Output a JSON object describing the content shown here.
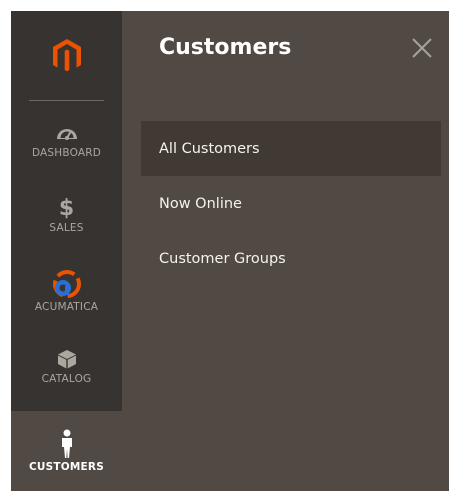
{
  "sidebar": {
    "logo_icon": "magento-logo-icon",
    "items": [
      {
        "label": "DASHBOARD",
        "icon": "dashboard-gauge-icon"
      },
      {
        "label": "SALES",
        "icon": "dollar-icon"
      },
      {
        "label": "ACUMATICA",
        "icon": "acumatica-logo-icon"
      },
      {
        "label": "CATALOG",
        "icon": "box-icon"
      },
      {
        "label": "CUSTOMERS",
        "icon": "person-icon"
      }
    ],
    "active_item": "CUSTOMERS"
  },
  "panel": {
    "title": "Customers",
    "close_icon": "close-icon",
    "items": [
      {
        "label": "All Customers"
      },
      {
        "label": "Now Online"
      },
      {
        "label": "Customer Groups"
      }
    ],
    "active_item": "All Customers"
  },
  "colors": {
    "sidebar_bg": "#373330",
    "panel_bg": "#514943",
    "accent": "#eb5202",
    "active_item_bg": "#403934"
  }
}
